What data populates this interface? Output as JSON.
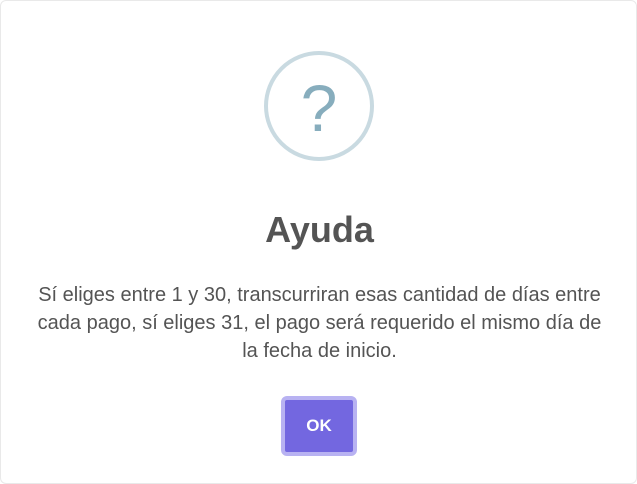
{
  "dialog": {
    "icon": "question-mark-icon",
    "icon_glyph": "?",
    "title": "Ayuda",
    "message": "Sí eliges entre 1 y 30, transcurriran esas cantidad de días entre cada pago, sí eliges 31, el pago será requerido el mismo día de la fecha de inicio.",
    "confirm_label": "OK"
  },
  "colors": {
    "icon_border": "#c9dae1",
    "icon_glyph": "#87adbd",
    "text": "#545454",
    "button_bg": "#7367e0",
    "button_focus_ring": "#b8b2f2"
  }
}
